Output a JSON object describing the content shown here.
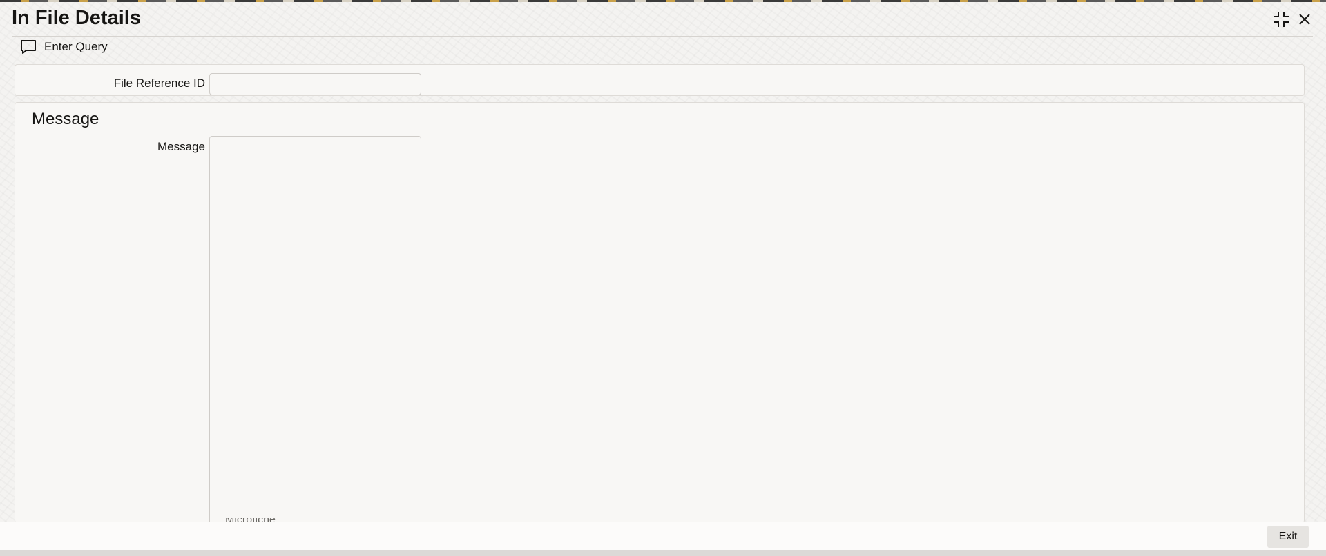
{
  "window": {
    "title": "In File Details",
    "maximize_icon": "collapse-icon",
    "close_icon": "close-icon"
  },
  "toolbar": {
    "enter_query_label": "Enter Query",
    "enter_query_icon": "chat-bubble-icon"
  },
  "fields": {
    "file_reference_id_label": "File Reference ID",
    "file_reference_id_value": ""
  },
  "message_section": {
    "title": "Message",
    "message_label": "Message",
    "message_value": "",
    "partial_text": "Microfiche"
  },
  "footer": {
    "exit_label": "Exit"
  }
}
